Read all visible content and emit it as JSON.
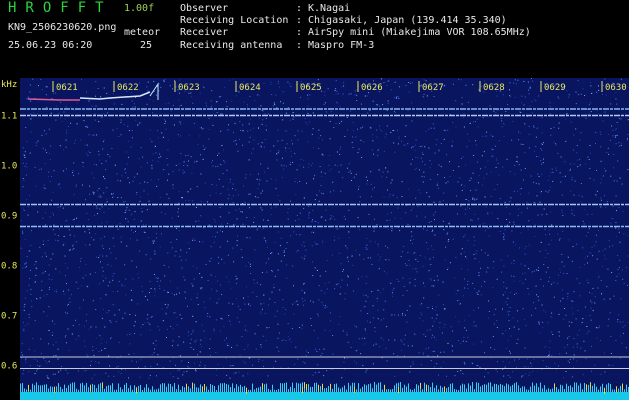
{
  "header": {
    "title": "HROFFT",
    "version": "1.00f",
    "filename": "KN9_2506230620.png",
    "datetime": "25.06.23 06:20",
    "meteor_label": "meteor",
    "meteor_count": "25",
    "info": [
      {
        "label": "Observer",
        "value": "K.Nagai"
      },
      {
        "label": "Receiving Location",
        "value": "Chigasaki, Japan (139.414 35.340)"
      },
      {
        "label": "Receiver",
        "value": "AirSpy mini (Miakejima VOR 108.65MHz)"
      },
      {
        "label": "Receiving antenna",
        "value": "Maspro FM-3"
      }
    ]
  },
  "spectrogram": {
    "unit_label": "kHz",
    "time_labels": [
      "0621",
      "0622",
      "0623",
      "0624",
      "0625",
      "0626",
      "0627",
      "0628",
      "0629",
      "0630"
    ],
    "freq_labels": [
      "1.1",
      "1.0",
      "0.9",
      "0.8",
      "0.7",
      "0.6"
    ],
    "freq_range_khz": [
      0.575,
      1.175
    ],
    "background_color": "#0a1560",
    "label_color": "#e8e860",
    "carrier_lines": [
      {
        "freq_khz": 1.113,
        "color": "#8fc8ff"
      },
      {
        "freq_khz": 1.1,
        "color": "#c0e0ff"
      },
      {
        "freq_khz": 0.922,
        "color": "#b0d8ff"
      },
      {
        "freq_khz": 0.878,
        "color": "#9ccfff"
      }
    ],
    "reference_lines_khz": [
      0.617,
      0.594
    ]
  }
}
